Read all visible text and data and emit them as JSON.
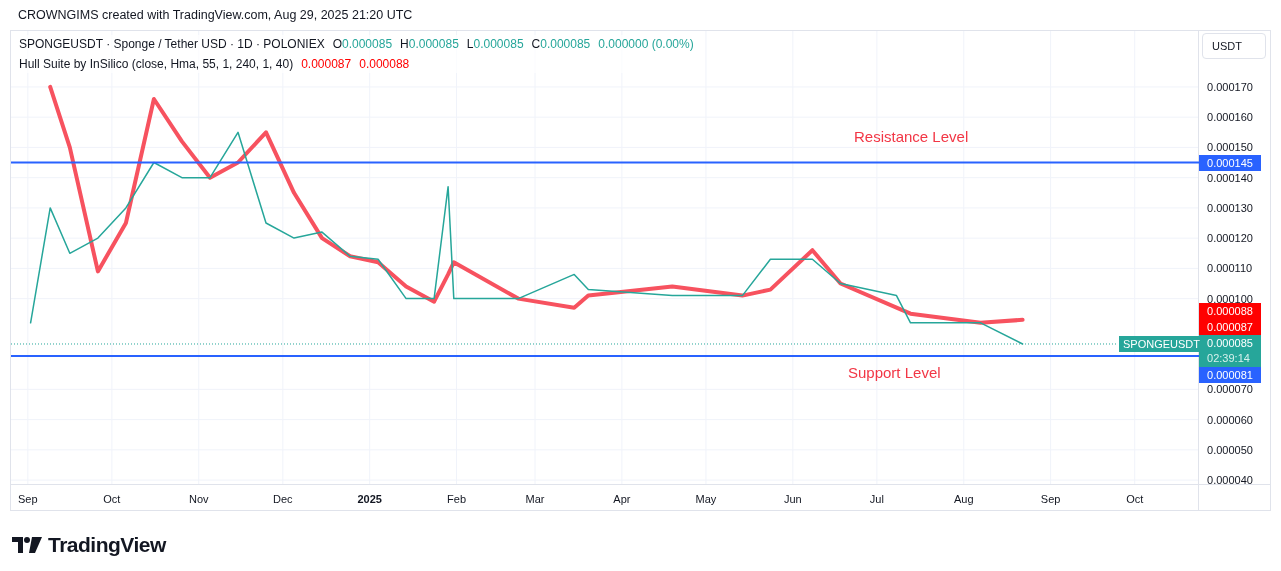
{
  "attribution": "CROWNGIMS created with TradingView.com, Aug 29, 2025 21:20 UTC",
  "legend": {
    "symbol": "SPONGEUSDT · Sponge / Tether USD · 1D · POLONIEX",
    "ohlc": [
      {
        "label": "O",
        "value": "0.000085"
      },
      {
        "label": "H",
        "value": "0.000085"
      },
      {
        "label": "L",
        "value": "0.000085"
      },
      {
        "label": "C",
        "value": "0.000085"
      }
    ],
    "change": "0.000000 (0.00%)",
    "indicator": "Hull Suite by InSilico (close, Hma, 55, 1, 240, 1, 40)",
    "indicator_values": [
      "0.000087",
      "0.000088"
    ]
  },
  "currency_button": "USDT",
  "levels": [
    {
      "kind": "resistance",
      "label": "Resistance Level",
      "price": "0.000145"
    },
    {
      "kind": "support",
      "label": "Support Level",
      "price": "0.000081"
    }
  ],
  "price_tags": [
    {
      "kind": "indicator",
      "value": "0.000088"
    },
    {
      "kind": "indicator",
      "value": "0.000087"
    },
    {
      "kind": "last",
      "value": "0.000085",
      "countdown": "02:39:14",
      "symbol": "SPONGEUSDT"
    }
  ],
  "chart_data": {
    "type": "line",
    "xlim": [
      "2024-08-26",
      "2025-11-19"
    ],
    "ylim": [
      3.87e-05,
      0.0001885
    ],
    "grid": true,
    "x": [
      "2024-09-02",
      "2024-09-09",
      "2024-09-16",
      "2024-09-26",
      "2024-10-06",
      "2024-10-16",
      "2024-10-26",
      "2024-11-05",
      "2024-11-15",
      "2024-11-25",
      "2024-12-05",
      "2024-12-15",
      "2024-12-25",
      "2025-01-04",
      "2025-01-14",
      "2025-01-24",
      "2025-01-29",
      "2025-01-31",
      "2025-02-23",
      "2025-03-15",
      "2025-03-20",
      "2025-04-19",
      "2025-05-14",
      "2025-05-24",
      "2025-06-08",
      "2025-06-18",
      "2025-07-08",
      "2025-07-13",
      "2025-08-07",
      "2025-08-22"
    ],
    "xticks": [
      {
        "value": "2024-09-01",
        "label": "Sep"
      },
      {
        "value": "2024-10-01",
        "label": "Oct"
      },
      {
        "value": "2024-11-01",
        "label": "Nov"
      },
      {
        "value": "2024-12-01",
        "label": "Dec"
      },
      {
        "value": "2025-01-01",
        "label": "2025"
      },
      {
        "value": "2025-02-01",
        "label": "Feb"
      },
      {
        "value": "2025-03-01",
        "label": "Mar"
      },
      {
        "value": "2025-04-01",
        "label": "Apr"
      },
      {
        "value": "2025-05-01",
        "label": "May"
      },
      {
        "value": "2025-06-01",
        "label": "Jun"
      },
      {
        "value": "2025-07-01",
        "label": "Jul"
      },
      {
        "value": "2025-08-01",
        "label": "Aug"
      },
      {
        "value": "2025-09-01",
        "label": "Sep"
      },
      {
        "value": "2025-10-01",
        "label": "Oct"
      }
    ],
    "yticks": [
      {
        "value": 4e-05,
        "label": "0.000040"
      },
      {
        "value": 5e-05,
        "label": "0.000050"
      },
      {
        "value": 6e-05,
        "label": "0.000060"
      },
      {
        "value": 7e-05,
        "label": "0.000070"
      },
      {
        "value": 0.0001,
        "label": "0.000100"
      },
      {
        "value": 0.00011,
        "label": "0.000110"
      },
      {
        "value": 0.00012,
        "label": "0.000120"
      },
      {
        "value": 0.00013,
        "label": "0.000130"
      },
      {
        "value": 0.00014,
        "label": "0.000140"
      },
      {
        "value": 0.00015,
        "label": "0.000150"
      },
      {
        "value": 0.00016,
        "label": "0.000160"
      },
      {
        "value": 0.00017,
        "label": "0.000170"
      }
    ],
    "series": [
      {
        "color": "#26a69a",
        "values": [
          9.2e-05,
          0.00013,
          0.000115,
          0.00012,
          0.00013,
          0.000145,
          0.00014,
          0.00014,
          0.000155,
          0.000125,
          0.00012,
          0.000122,
          0.000114,
          0.000113,
          0.0001,
          0.0001,
          0.000137,
          0.0001,
          0.0001,
          0.000108,
          0.000103,
          0.000101,
          0.000101,
          0.000113,
          0.000113,
          0.000105,
          0.000101,
          9.2e-05,
          9.2e-05,
          8.5e-05
        ]
      },
      {
        "color": "#f7525f",
        "values": [
          null,
          0.00017,
          0.00015,
          0.000109,
          0.000125,
          0.000166,
          0.000152,
          0.00014,
          0.000145,
          0.000155,
          0.000135,
          0.00012,
          0.000114,
          0.000112,
          0.000104,
          9.9e-05,
          0.000108,
          0.000112,
          0.0001,
          9.7e-05,
          0.000101,
          0.000104,
          0.000101,
          0.000103,
          0.000116,
          0.000105,
          9.7e-05,
          9.5e-05,
          9.2e-05,
          9.3e-05
        ]
      }
    ]
  },
  "logo": "TradingView"
}
